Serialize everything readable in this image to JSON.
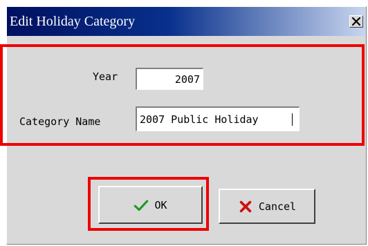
{
  "window": {
    "title": "Edit Holiday Category",
    "close_glyph": "✕"
  },
  "form": {
    "year_label": "Year",
    "year_value": "2007",
    "category_name_label": "Category Name",
    "category_name_value": "2007 Public Holiday"
  },
  "buttons": {
    "ok_label": "OK",
    "cancel_label": "Cancel"
  },
  "icons": {
    "close": "close-icon",
    "ok": "checkmark-icon",
    "cancel": "cross-icon"
  },
  "colors": {
    "title_start": "#001060",
    "title_mid": "#08308c",
    "title_end": "#c8d6ef",
    "highlight": "#ee0000",
    "ok_icon": "#1f9a1f",
    "cancel_icon": "#cc1010"
  }
}
